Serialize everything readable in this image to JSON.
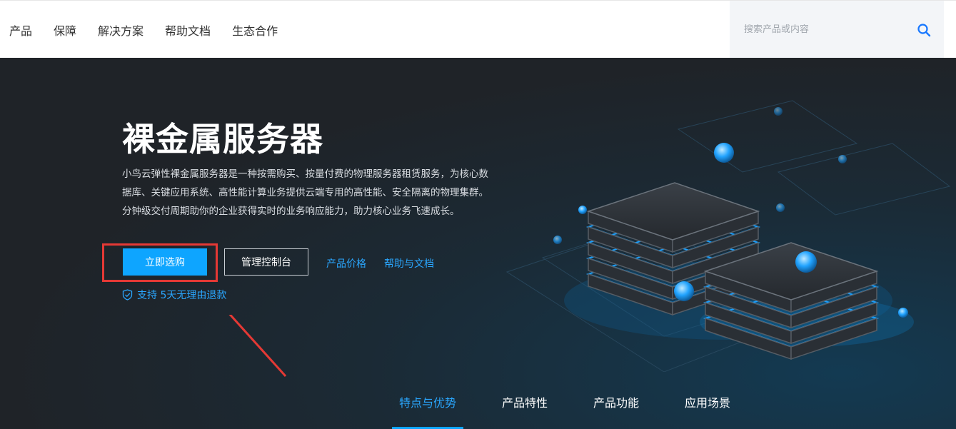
{
  "nav": {
    "items": [
      "产品",
      "保障",
      "解决方案",
      "帮助文档",
      "生态合作"
    ],
    "search_placeholder": "搜索产品或内容"
  },
  "hero": {
    "title": "裸金属服务器",
    "description": "小鸟云弹性裸金属服务器是一种按需购买、按量付费的物理服务器租赁服务，为核心数据库、关键应用系统、高性能计算业务提供云端专用的高性能、安全隔离的物理集群。分钟级交付周期助你的企业获得实时的业务响应能力，助力核心业务飞速成长。",
    "buy_button": "立即选购",
    "console_button": "管理控制台",
    "price_link": "产品价格",
    "help_link": "帮助与文档",
    "support_text": "支持 5天无理由退款"
  },
  "tabs": [
    {
      "label": "特点与优势",
      "active": true
    },
    {
      "label": "产品特性",
      "active": false
    },
    {
      "label": "产品功能",
      "active": false
    },
    {
      "label": "应用场景",
      "active": false
    }
  ],
  "colors": {
    "accent": "#0ea5ff",
    "link": "#2aa7ff",
    "hero_bg": "#1f2328",
    "annotation": "#e53935"
  }
}
